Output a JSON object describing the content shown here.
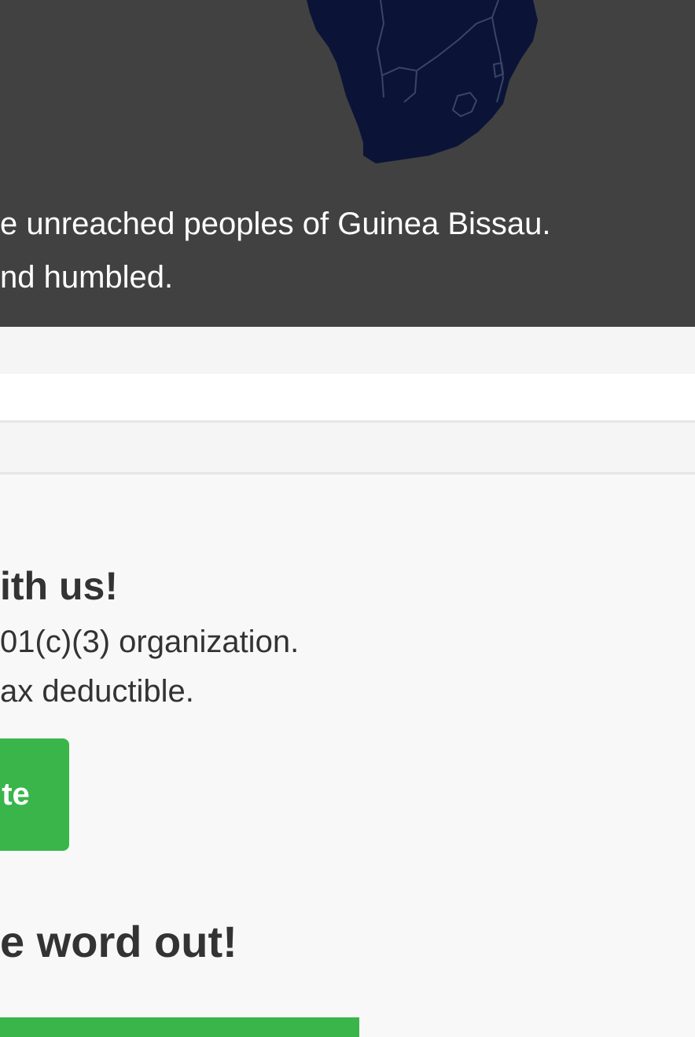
{
  "hero": {
    "line1": "e unreached peoples of Guinea Bissau.",
    "line2": "nd humbled.",
    "map_fill_color": "#0b1437",
    "background_color": "#414141"
  },
  "give": {
    "heading": "ith us!",
    "line1": "01(c)(3) organization.",
    "line2": "ax deductible.",
    "button_label": "te",
    "button_color": "#39b54a"
  },
  "share": {
    "heading": "e word out!"
  }
}
